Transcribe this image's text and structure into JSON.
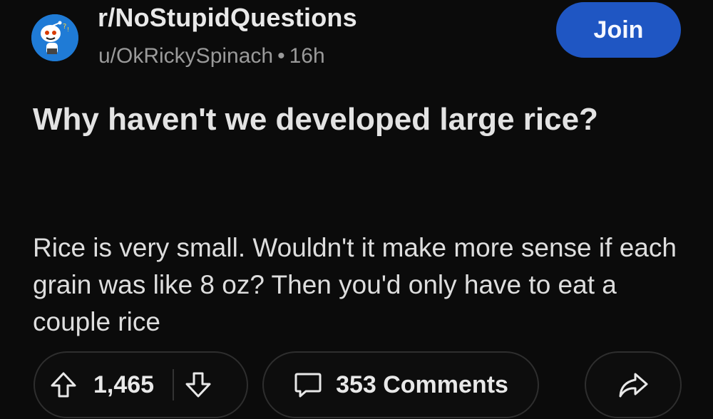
{
  "post": {
    "subreddit": "r/NoStupidQuestions",
    "author": "u/OkRickySpinach",
    "separator": "•",
    "time_ago": "16h",
    "title": "Why haven't we developed large rice?",
    "body": "Rice is very small. Wouldn't it make more sense if each grain was like 8 oz? Then you'd only have to eat a couple rice"
  },
  "header": {
    "join_label": "Join"
  },
  "actions": {
    "score": "1,465",
    "comments_label": "353 Comments"
  },
  "icons": {
    "avatar": "subreddit-avatar",
    "upvote": "arrow-up-icon",
    "downvote": "arrow-down-icon",
    "comments": "comment-bubble-icon",
    "share": "share-arrow-icon"
  },
  "colors": {
    "background": "#0b0b0b",
    "join_button": "#1f56c3",
    "avatar_bg": "#1f7bd6",
    "meta_text": "#9a9a9a"
  }
}
